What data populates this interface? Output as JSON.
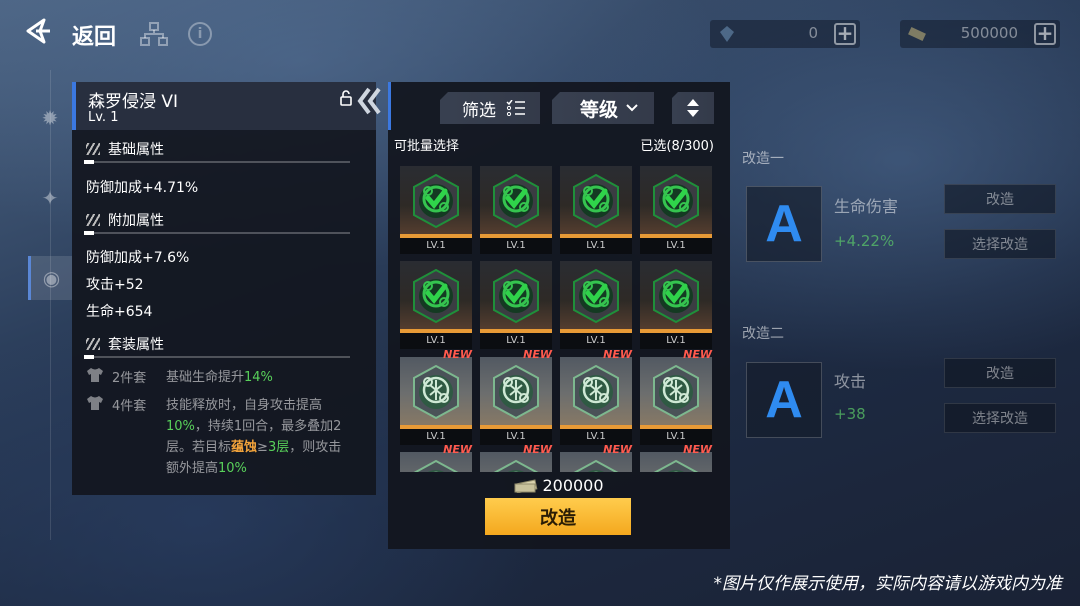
{
  "header": {
    "back_label": "返回",
    "resource1_value": "0",
    "resource2_value": "500000"
  },
  "detail": {
    "name": "森罗侵浸 VI",
    "level": "Lv. 1",
    "base_title": "基础属性",
    "base_attrs": [
      "防御加成+4.71%"
    ],
    "extra_title": "附加属性",
    "extra_attrs": [
      "防御加成+7.6%",
      "攻击+52",
      "生命+654"
    ],
    "set_title": "套装属性",
    "set2_count": "2件套",
    "set2_desc_a": "基础生命提升",
    "set2_desc_b": "14%",
    "set4_count": "4件套",
    "set4_parts": [
      "技能释放时，自身攻击提高",
      "10%",
      "，持续1回合，最多叠加2层。若目标",
      "蕴蚀",
      "≥",
      "3层",
      "，则攻击额外提高",
      "10%"
    ]
  },
  "picker": {
    "filter_label": "筛选",
    "sort_label": "等级",
    "batch_label": "可批量选择",
    "selected_count": "已选(8/300)",
    "new_label": "NEW",
    "items": [
      {
        "level": "LV.1",
        "selected": true,
        "new": false
      },
      {
        "level": "LV.1",
        "selected": true,
        "new": false
      },
      {
        "level": "LV.1",
        "selected": true,
        "new": false
      },
      {
        "level": "LV.1",
        "selected": true,
        "new": false
      },
      {
        "level": "LV.1",
        "selected": true,
        "new": false
      },
      {
        "level": "LV.1",
        "selected": true,
        "new": false
      },
      {
        "level": "LV.1",
        "selected": true,
        "new": false
      },
      {
        "level": "LV.1",
        "selected": true,
        "new": false
      },
      {
        "level": "LV.1",
        "selected": false,
        "new": true
      },
      {
        "level": "LV.1",
        "selected": false,
        "new": true
      },
      {
        "level": "LV.1",
        "selected": false,
        "new": true
      },
      {
        "level": "LV.1",
        "selected": false,
        "new": true
      },
      {
        "level": "",
        "selected": false,
        "new": true
      },
      {
        "level": "",
        "selected": false,
        "new": true
      },
      {
        "level": "",
        "selected": false,
        "new": true
      },
      {
        "level": "",
        "selected": false,
        "new": true
      }
    ],
    "cost": "200000",
    "modify_label": "改造"
  },
  "right_panel": {
    "slot1_title": "改造一",
    "slot1_stat": "生命伤害",
    "slot1_value": "+4.22%",
    "slot2_title": "改造二",
    "slot2_stat": "攻击",
    "slot2_value": "+38",
    "grade_letter": "A",
    "modify_label": "改造",
    "alt_modify_label": "选择改造"
  },
  "disclaimer": "*图片仅作展示使用，实际内容请以游戏内为准",
  "colors": {
    "accent_blue": "#3b78e0",
    "green": "#58d05a",
    "orange": "#f2a33b",
    "button_yellow": "#f4a81e",
    "new_red": "#ff5a4e"
  }
}
